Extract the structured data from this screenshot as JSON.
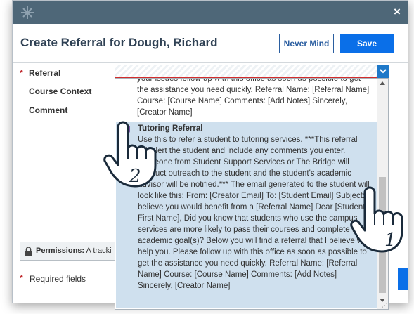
{
  "dialog": {
    "title": "Create Referral for Dough, Richard",
    "never_mind_label": "Never Mind",
    "save_label": "Save",
    "close_glyph": "×"
  },
  "form": {
    "referral_label": "Referral",
    "course_context_label": "Course Context",
    "comment_label": "Comment",
    "required_star": "*",
    "permissions_label": "Permissions:",
    "permissions_text": "A tracki",
    "required_fields_label": "Required fields"
  },
  "dropdown": {
    "previous_item_text": "your issues follow up with this office as soon as possible to get the assistance you need quickly. Referral Name: [Referral Name] Course: [Course Name] Comments: [Add Notes] Sincerely, [Creator Name]",
    "selected_item": {
      "title": "Tutoring Referral",
      "description": "Use this to refer a student to tutoring services. ***This referral will alert the student and include any comments you enter. Someone from Student Support Services or The Bridge will conduct outreach to the student and the student's academic advisor will be notified.*** The email generated to the student will look like this: From: [Creator Email] To: [Student Email] Subject: I believe you would benefit from a [Referral Name] Dear [Student First Name], Did you know that students who use the campus services are more likely to pass their courses and complete their academic goal(s)? Below you will find a referral that I believe will help you. Please follow up with this office as soon as possible to get the assistance you need quickly. Referral Name: [Referral Name] Course: [Course Name] Comments: [Add Notes] Sincerely, [Creator Name]"
    }
  },
  "annotations": {
    "step_1": "1",
    "step_2": "2"
  },
  "icons": {
    "drag": "drag-handle-icon",
    "close": "close-icon",
    "caret": "chevron-down-icon",
    "lock": "lock-icon",
    "referral_item": "referral-icon",
    "pointer": "hand-pointer-icon"
  },
  "colors": {
    "titlebar": "#4e6778",
    "title_text": "#2f4154",
    "save_button": "#0a6fe8",
    "never_mind_border": "#2b5ea0",
    "required": "#c0282d",
    "selected_item_bg": "#cfe0ee"
  }
}
